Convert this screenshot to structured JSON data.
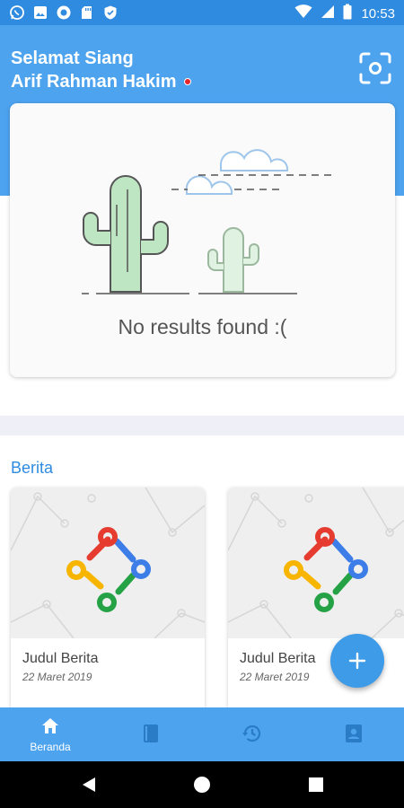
{
  "status_bar": {
    "time": "10:53",
    "icons": [
      "whatsapp-icon",
      "image-app-icon",
      "circle-app-icon",
      "sd-card-icon",
      "shield-icon",
      "wifi-icon",
      "signal-icon",
      "battery-icon"
    ]
  },
  "header": {
    "greeting": "Selamat Siang",
    "user_name": "Arif Rahman Hakim",
    "scan_icon": "scan-icon",
    "online_color": "#e8252b"
  },
  "empty_state": {
    "message": "No results found :("
  },
  "news": {
    "section_title": "Berita",
    "items": [
      {
        "title": "Judul Berita",
        "date": "22 Maret 2019"
      },
      {
        "title": "Judul Berita",
        "date": "22 Maret 2019"
      }
    ]
  },
  "fab": {
    "icon": "plus-icon"
  },
  "bottom_nav": {
    "items": [
      {
        "label": "Beranda",
        "icon": "home-icon",
        "active": true
      },
      {
        "label": "",
        "icon": "book-icon",
        "active": false
      },
      {
        "label": "",
        "icon": "history-icon",
        "active": false
      },
      {
        "label": "",
        "icon": "contact-card-icon",
        "active": false
      }
    ]
  },
  "colors": {
    "primary": "#4da3ee",
    "status_bar": "#2f8be0",
    "accent": "#3d9be8",
    "section_title": "#2f8be0"
  }
}
